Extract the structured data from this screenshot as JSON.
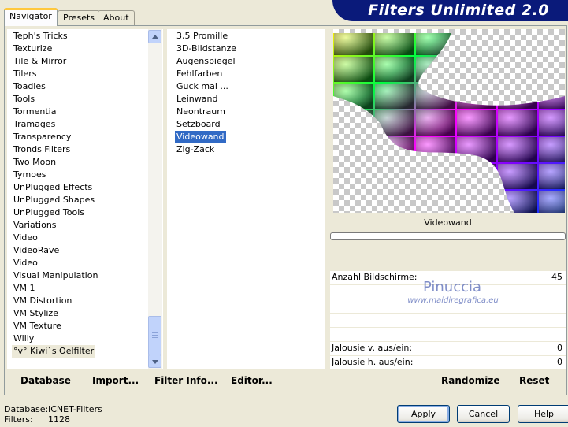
{
  "tabs": [
    {
      "label": "Navigator",
      "active": true
    },
    {
      "label": "Presets",
      "active": false
    },
    {
      "label": "About",
      "active": false
    }
  ],
  "app_title": "Filters Unlimited 2.0",
  "categories": [
    "Teph's Tricks",
    "Texturize",
    "Tile & Mirror",
    "Tilers",
    "Toadies",
    "Tools",
    "Tormentia",
    "Tramages",
    "Transparency",
    "Tronds Filters",
    "Two Moon",
    "Tymoes",
    "UnPlugged Effects",
    "UnPlugged Shapes",
    "UnPlugged Tools",
    "Variations",
    "Video",
    "VideoRave",
    "Video",
    "Visual Manipulation",
    "VM 1",
    "VM Distortion",
    "VM Stylize",
    "VM Texture",
    "Willy",
    "°v° Kiwi`s Oelfilter"
  ],
  "selected_category": "°v° Kiwi`s Oelfilter",
  "filters": [
    "3,5 Promille",
    "3D-Bildstanze",
    "Augenspiegel",
    "Fehlfarben",
    "Guck mal ...",
    "Leinwand",
    "Neontraum",
    "Setzboard",
    "Videowand",
    "Zig-Zack"
  ],
  "selected_filter": "Videowand",
  "preview": {
    "filter_name": "Videowand",
    "watermark_line1": "Pinuccia",
    "watermark_line2": "www.maidiregrafica.eu"
  },
  "params": [
    {
      "label": "Anzahl Bildschirme:",
      "value": "45"
    },
    {
      "label": "Jalousie v. aus/ein:",
      "value": "0"
    },
    {
      "label": "Jalousie h. aus/ein:",
      "value": "0"
    }
  ],
  "toolbar": {
    "database": "Database",
    "import": "Import...",
    "filter_info": "Filter Info...",
    "editor": "Editor...",
    "randomize": "Randomize",
    "reset": "Reset"
  },
  "status": {
    "database_label": "Database:",
    "database_value": "ICNET-Filters",
    "filters_label": "Filters:",
    "filters_value": "1128"
  },
  "buttons": {
    "apply": "Apply",
    "cancel": "Cancel",
    "help": "Help"
  },
  "colors": {
    "banner": "#0a1a7a",
    "selection": "#316ac5",
    "background": "#ece9d8"
  }
}
